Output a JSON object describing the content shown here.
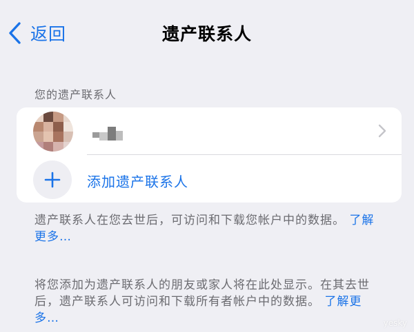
{
  "nav": {
    "back_label": "返回",
    "title": "遗产联系人"
  },
  "section": {
    "header": "您的遗产联系人"
  },
  "add_contact": {
    "label": "添加遗产联系人"
  },
  "footer1": {
    "text": "遗产联系人在您去世后，可访问和下载您帐户中的数据。",
    "link": "了解更多…"
  },
  "footer2": {
    "text": "将您添加为遗产联系人的朋友或家人将在此处显示。在其去世后，遗产联系人可访问和下载所有者帐户中的数据。",
    "link": "了解更多…"
  },
  "watermark": "yesky",
  "colors": {
    "background": "#efeff4",
    "card": "#ffffff",
    "accent": "#1a73e8",
    "secondary_text": "#6b6b70"
  },
  "icons": {
    "back": "chevron-left-icon",
    "row": "chevron-right-icon",
    "add": "plus-icon"
  }
}
